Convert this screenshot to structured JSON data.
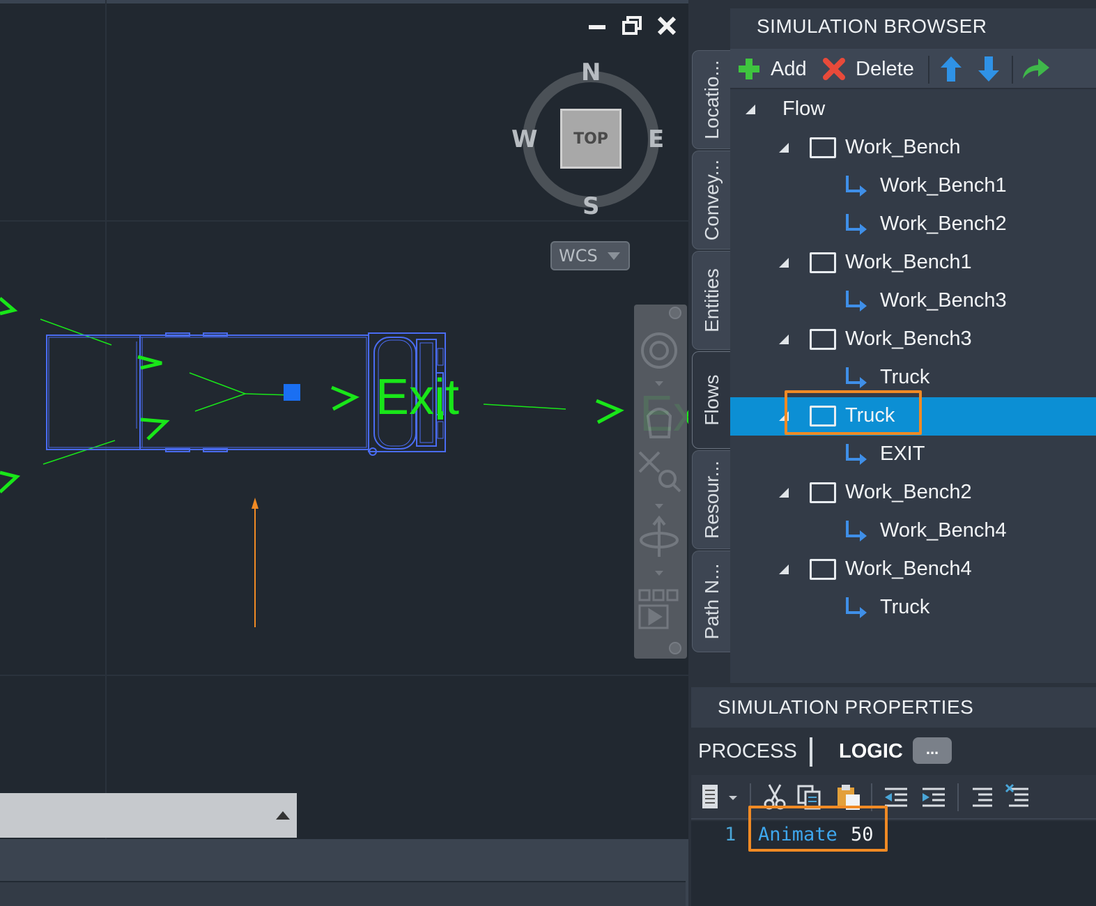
{
  "viewport": {
    "viewcube": {
      "north": "N",
      "south": "S",
      "east": "E",
      "west": "W",
      "face": "TOP"
    },
    "ucs_menu": "WCS",
    "labels": [
      "Exit",
      "Ex"
    ]
  },
  "browser": {
    "title": "SIMULATION BROWSER",
    "toolbar": {
      "add": "Add",
      "delete": "Delete"
    },
    "tree": [
      {
        "label": "Flow",
        "type": "root"
      },
      {
        "label": "Work_Bench",
        "type": "node"
      },
      {
        "label": "Work_Bench1",
        "type": "link"
      },
      {
        "label": "Work_Bench2",
        "type": "link"
      },
      {
        "label": "Work_Bench1",
        "type": "node"
      },
      {
        "label": "Work_Bench3",
        "type": "link"
      },
      {
        "label": "Work_Bench3",
        "type": "node"
      },
      {
        "label": "Truck",
        "type": "link"
      },
      {
        "label": "Truck",
        "type": "node",
        "selected": true
      },
      {
        "label": "EXIT",
        "type": "link"
      },
      {
        "label": "Work_Bench2",
        "type": "node"
      },
      {
        "label": "Work_Bench4",
        "type": "link"
      },
      {
        "label": "Work_Bench4",
        "type": "node"
      },
      {
        "label": "Truck",
        "type": "link"
      }
    ]
  },
  "side_tabs": [
    "Locatio...",
    "Convey...",
    "Entities",
    "Flows",
    "Resour...",
    "Path N..."
  ],
  "properties": {
    "title": "SIMULATION PROPERTIES",
    "tabs": {
      "process": "PROCESS",
      "logic": "LOGIC",
      "more": "..."
    },
    "code": {
      "line_number": "1",
      "keyword": "Animate",
      "value": "50"
    }
  },
  "colors": {
    "accent": "#0c8fd4",
    "highlight": "#f08a24",
    "cad_green": "#19e619",
    "cad_blue": "#4a6cf2"
  }
}
